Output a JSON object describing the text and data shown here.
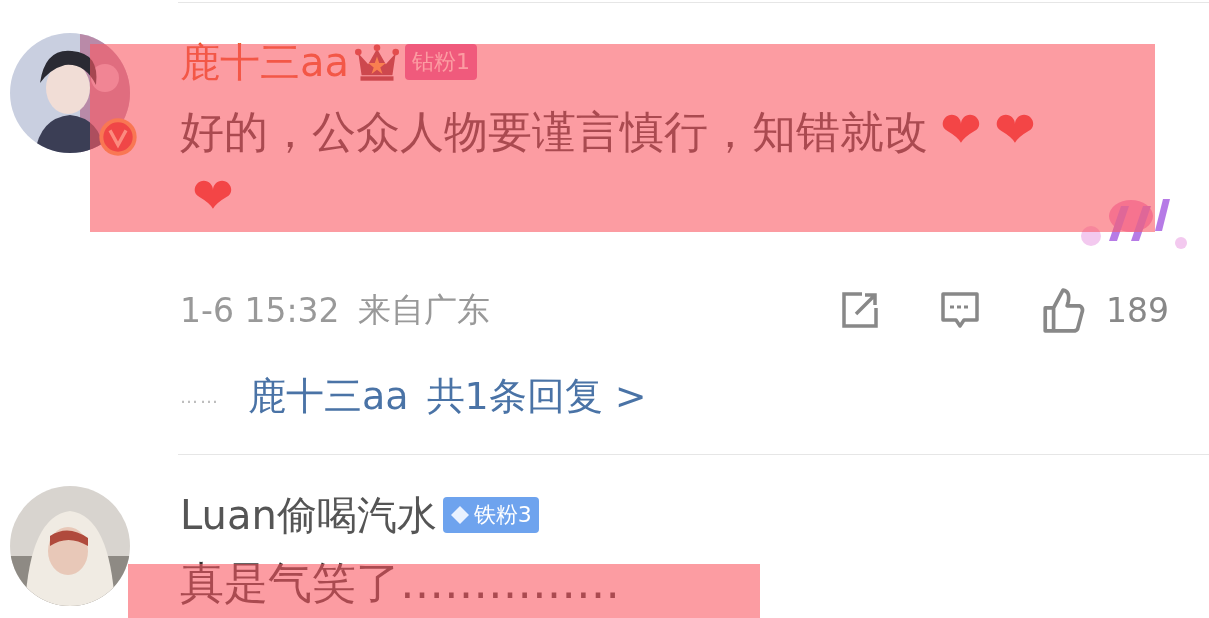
{
  "comments": [
    {
      "username": "鹿十三aa",
      "vip": true,
      "crown": true,
      "badge": {
        "kind": "diamond_fan",
        "label": "钻粉1"
      },
      "verified": true,
      "text": "好的，公众人物要谨言慎行，知错就改",
      "emoji": [
        "❤",
        "❤",
        "❤"
      ],
      "sticker": true,
      "highlighted": true,
      "time": "1-6 15:32",
      "location": "来自广东",
      "likes": "189",
      "reply_summary": {
        "dots": "……",
        "author": "鹿十三aa",
        "count": "共1条回复 >"
      }
    },
    {
      "username": "Luan偷喝汽水",
      "vip": false,
      "badge": {
        "kind": "iron_fan",
        "label": "铁粉3"
      },
      "text": "真是气笑了……………",
      "highlighted": true
    }
  ]
}
